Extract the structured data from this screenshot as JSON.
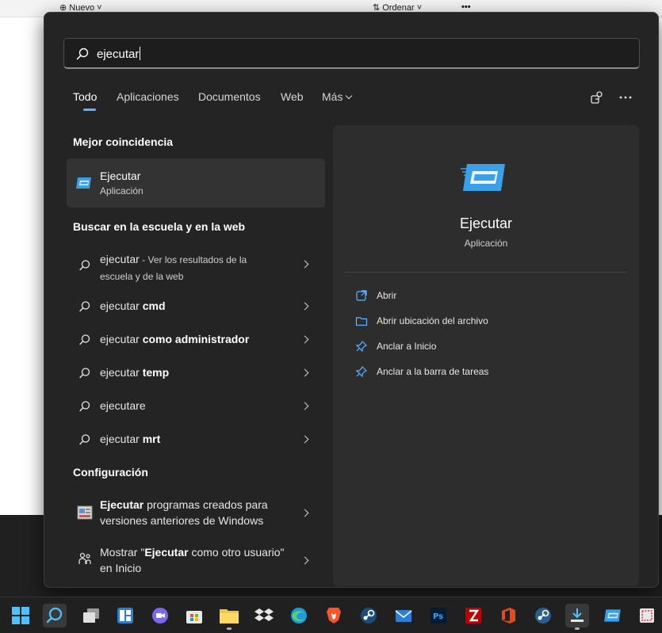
{
  "background": {
    "toolbar": {
      "new_label": "Nuevo",
      "sort_label": "Ordenar",
      "more_label": "•••"
    }
  },
  "search": {
    "value": "ejecutar"
  },
  "tabs": [
    {
      "label": "Todo",
      "active": true
    },
    {
      "label": "Aplicaciones",
      "active": false
    },
    {
      "label": "Documentos",
      "active": false
    },
    {
      "label": "Web",
      "active": false
    },
    {
      "label": "Más",
      "active": false
    }
  ],
  "sections": {
    "best_match": "Mejor coincidencia",
    "web": "Buscar en la escuela y en la web",
    "settings": "Configuración"
  },
  "best_match": {
    "title": "Ejecutar",
    "subtitle": "Aplicación"
  },
  "web_results": [
    {
      "query": "ejecutar",
      "bold": "",
      "suffix": " - Ver los resultados de la escuela y de la web"
    },
    {
      "query": "ejecutar ",
      "bold": "cmd"
    },
    {
      "query": "ejecutar ",
      "bold": "como administrador"
    },
    {
      "query": "ejecutar ",
      "bold": "temp"
    },
    {
      "query": "ejecutar",
      "bold": "e"
    },
    {
      "query": "ejecutar ",
      "bold": "mrt"
    }
  ],
  "settings_results": [
    {
      "bold": "Ejecutar",
      "rest": " programas creados para versiones anteriores de Windows"
    },
    {
      "pre": "Mostrar \"",
      "bold": "Ejecutar",
      "rest": " como otro usuario\" en Inicio"
    }
  ],
  "detail": {
    "title": "Ejecutar",
    "subtitle": "Aplicación",
    "actions": [
      "Abrir",
      "Abrir ubicación del archivo",
      "Anclar a Inicio",
      "Anclar a la barra de tareas"
    ]
  },
  "icons": {
    "search": "search-icon",
    "run_app": "run-app-icon",
    "chevron": "chevron-right-icon"
  },
  "colors": {
    "accent": "#62b3ff",
    "flyout_bg": "#242424",
    "detail_bg": "#2d2d2d"
  },
  "taskbar": {
    "items": [
      "windows-start",
      "search",
      "task-view",
      "widgets",
      "chat",
      "store",
      "file-explorer",
      "dropbox",
      "edge",
      "brave",
      "steam",
      "mail",
      "photoshop",
      "filezilla",
      "office",
      "steam",
      "tool",
      "run",
      "snipping"
    ]
  }
}
